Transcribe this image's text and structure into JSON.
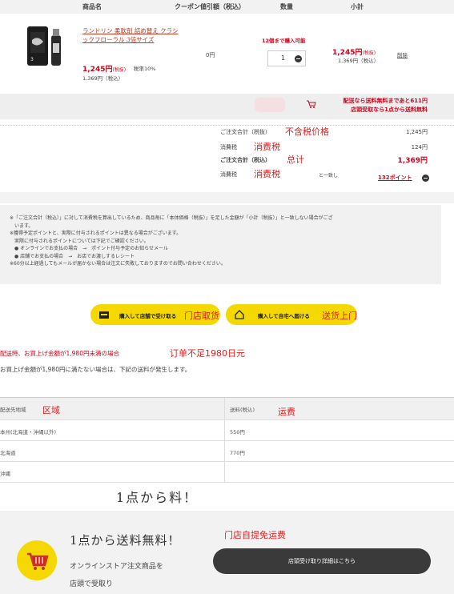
{
  "table_header": {
    "product": "商品名",
    "coupon": "クーポン値引額（税込）",
    "qty": "数量",
    "subtotal": "小計"
  },
  "product": {
    "name": "ランドリン 柔軟剤 詰め替え クラシックフローラル 3倍サイズ",
    "price": "1,245円",
    "price_suffix": "(税抜)",
    "tax_rate": "税率10%",
    "price_taxin": "1,369円（税込）",
    "coupon": "0円",
    "qty_note": "12個まで購入可能",
    "qty": "1",
    "subtotal": "1,245円",
    "subtotal_suffix": "(税抜)",
    "subtotal_taxin": "1,369円（税込）",
    "delete": "削除"
  },
  "shipping_msg": {
    "line1": "配送なら送料無料まであと611円",
    "line2": "店頭受取なら1点から送料無料"
  },
  "totals": {
    "subtotal_label": "ご注文合計（税抜）",
    "subtotal_value": "1,245円",
    "tax_label": "消費税",
    "tax_value": "124円",
    "total_label": "ご注文合計（税込）",
    "total_value": "1,369円",
    "tax2_label": "消費税",
    "partial_text": "と一致し",
    "points": "132ポイント"
  },
  "annotations": {
    "excl_tax": "不含税价格",
    "tax1": "消费税",
    "total": "总计",
    "tax2": "消费税",
    "store_pickup": "门店取货",
    "home_delivery": "送货上门",
    "under_1980": "订单不足1980日元",
    "region": "区域",
    "fee": "运费",
    "free_pickup": "门店自提免运费"
  },
  "notes": [
    "※「ご注文合計（税込）」に対して消費税を算出しているため、商品毎に「本体価格（税抜）」を足した金額が「小計（税抜）」と一致しない場合がござ",
    "　います。",
    "※獲得予定ポイントと、実際に付与されるポイントは異なる場合がございます。",
    "　実際に付与されるポイントについては下記でご確認ください。",
    "　● オンラインでお支払の場合　→　ポイント付与予定のお知らせメール",
    "　● 店舗でお支払の場合　→　お店でお渡しするレシート",
    "※60分以上経過してもメールが届かない場合は注文に失敗しておりますのでお問い合わせください。"
  ],
  "buttons": {
    "pickup": "購入して店舗で受け取る",
    "delivery": "購入して自宅へ届ける"
  },
  "shipping_info": {
    "line1": "配送時、お買上げ金額が1,980円未満の場合",
    "line2": "お買上げ金額が1,980円に満たない場合は、下記の送料が発生します。"
  },
  "region_table": {
    "head_region": "配送先地域",
    "head_fee": "送料(税込)",
    "rows": [
      {
        "region": "本州(北海道・沖縄以外)",
        "fee": "550円"
      },
      {
        "region": "北海道",
        "fee": "770円"
      },
      {
        "region": "沖縄",
        "fee": ""
      }
    ]
  },
  "faded_title": "1点から料！",
  "promo": {
    "title": "1点から送料無料！",
    "sub1": "オンラインストア注文商品を",
    "sub2": "店頭で受取り",
    "button": "店頭受け取り詳細はこちら"
  },
  "colors": {
    "accent_red": "#d0021b",
    "yellow": "#f5d800",
    "dark_button": "#3a3a3a"
  }
}
